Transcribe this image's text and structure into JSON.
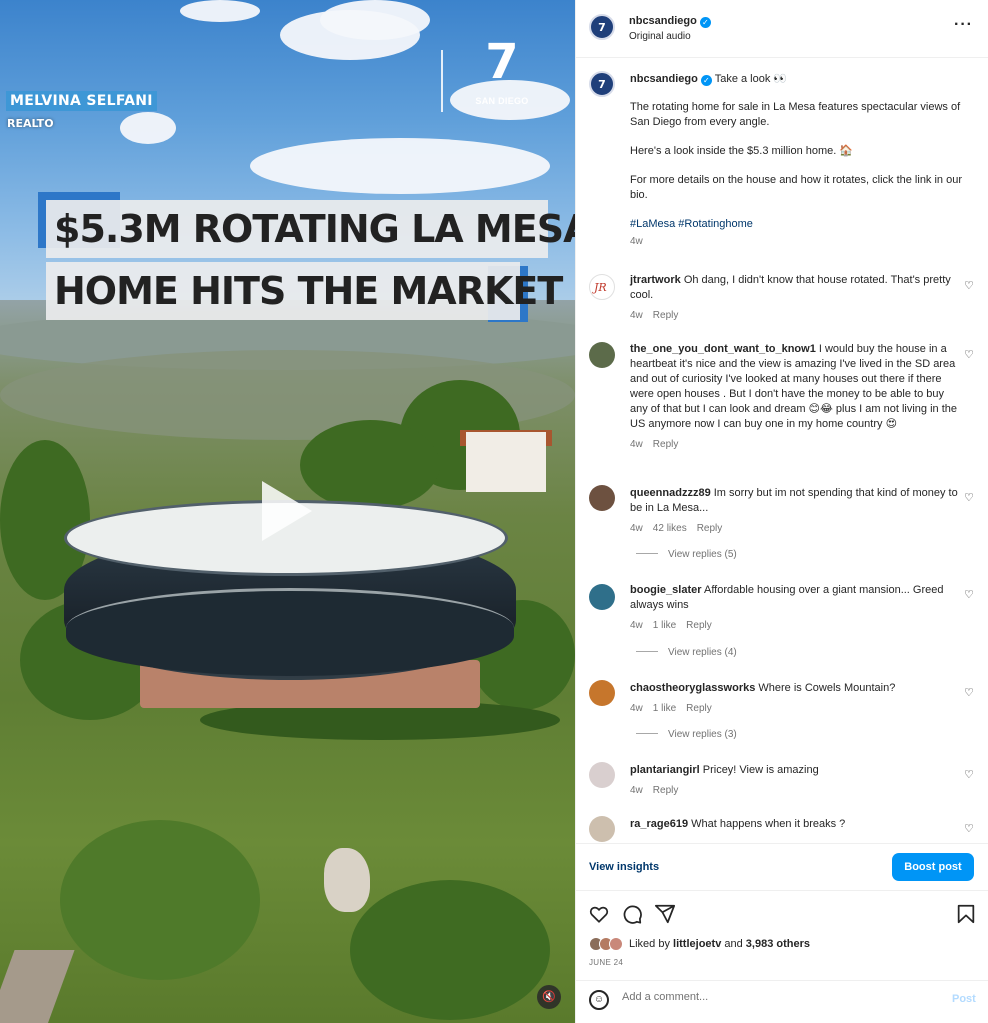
{
  "video": {
    "reporter_name": "MELVINA SELFANI",
    "reporter_role": "REALTO",
    "logo_number": "7",
    "logo_text": "SAN DIEGO",
    "headline_line1": "$5.3M ROTATING LA MESA",
    "headline_line2": "HOME HITS THE MARKET"
  },
  "header": {
    "avatar_text": "7",
    "username": "nbcsandiego",
    "audio": "Original audio",
    "more": "···"
  },
  "caption": {
    "username": "nbcsandiego",
    "first_line": "Take a look 👀",
    "para1": "The rotating home for sale in La Mesa features spectacular views of San Diego from every angle.",
    "para2": "Here's a look inside the $5.3 million home. 🏠",
    "para3": "For more details on the house and how it rotates, click the link in our bio.",
    "hashtags": "#LaMesa #Rotatinghome",
    "time": "4w"
  },
  "comments": [
    {
      "user": "jtrartwork",
      "text": "Oh dang, I didn't know that house rotated. That's pretty cool.",
      "time": "4w",
      "likes": "",
      "reply": "Reply",
      "color": "#ffffff"
    },
    {
      "user": "the_one_you_dont_want_to_know1",
      "text": "I would buy the house in a heartbeat it's nice and the view is amazing I've lived in the SD area and out of curiosity I've looked at many houses out there if there were open houses . But I don't have the money to be able to buy any of that but I can look and dream 😊😂 plus I am not living in the US anymore now I can buy one in my home country 😍",
      "time": "4w",
      "likes": "",
      "reply": "Reply",
      "color": "#5c6b4a"
    },
    {
      "user": "queennadzzz89",
      "text": "Im sorry but im not spending that kind of money to be in La Mesa...",
      "time": "4w",
      "likes": "42 likes",
      "reply": "Reply",
      "color": "#6d5140"
    },
    {
      "user": "boogie_slater",
      "text": "Affordable housing over a giant mansion... Greed always wins",
      "time": "4w",
      "likes": "1 like",
      "reply": "Reply",
      "color": "#2f6f8a"
    },
    {
      "user": "chaostheoryglassworks",
      "text": "Where is Cowels Mountain?",
      "time": "4w",
      "likes": "1 like",
      "reply": "Reply",
      "color": "#c6762c"
    },
    {
      "user": "plantariangirl",
      "text": "Pricey! View is amazing",
      "time": "4w",
      "likes": "",
      "reply": "Reply",
      "color": "#d9cfcf"
    },
    {
      "user": "ra_rage619",
      "text": "What happens when it breaks ?",
      "time": "",
      "likes": "",
      "reply": "",
      "color": "#cdbfae"
    }
  ],
  "view_replies": [
    "View replies (5)",
    "View replies (4)",
    "View replies (3)"
  ],
  "footer": {
    "view_insights": "View insights",
    "boost_post": "Boost post",
    "liked_prefix": "Liked by ",
    "liked_user": "littlejoetv",
    "liked_mid": " and ",
    "liked_count": "3,983 others",
    "date": "JUNE 24",
    "comment_placeholder": "Add a comment...",
    "post": "Post"
  },
  "icons": {
    "heart": "♡",
    "comment": "◯",
    "share": "▽",
    "save": "⌑",
    "mute": "🔇",
    "emoji": "☺"
  }
}
